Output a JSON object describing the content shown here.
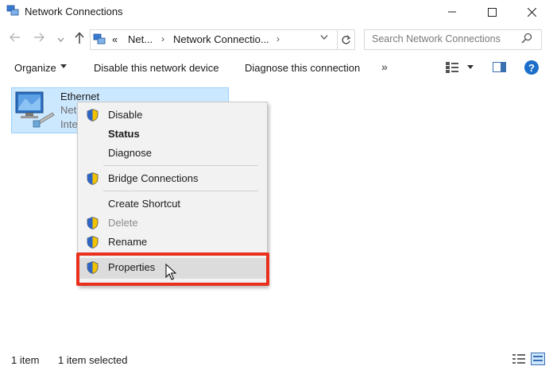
{
  "window": {
    "title": "Network Connections",
    "minimize_glyph": "—",
    "maximize_glyph": "☐",
    "close_glyph": "✕"
  },
  "nav": {
    "back_icon": "back-arrow-icon",
    "forward_icon": "forward-arrow-icon",
    "up_icon": "up-arrow-icon",
    "breadcrumb_prefix": "«",
    "breadcrumbs": [
      "Net...",
      "Network Connectio..."
    ],
    "refresh_icon": "refresh-icon"
  },
  "search": {
    "placeholder": "Search Network Connections"
  },
  "toolbar": {
    "organize_label": "Organize",
    "disable_label": "Disable this network device",
    "diagnose_label": "Diagnose this connection",
    "overflow_label": "»",
    "help_label": "?"
  },
  "connection": {
    "name": "Ethernet",
    "line2": "Net",
    "line3": "Inte"
  },
  "context_menu": {
    "items": [
      {
        "label": "Disable",
        "shield": true,
        "bold": false,
        "disabled": false
      },
      {
        "label": "Status",
        "shield": false,
        "bold": true,
        "disabled": false
      },
      {
        "label": "Diagnose",
        "shield": false,
        "bold": false,
        "disabled": false
      },
      {
        "label": "Bridge Connections",
        "shield": true,
        "bold": false,
        "disabled": false
      },
      {
        "label": "Create Shortcut",
        "shield": false,
        "bold": false,
        "disabled": false
      },
      {
        "label": "Delete",
        "shield": true,
        "bold": false,
        "disabled": true
      },
      {
        "label": "Rename",
        "shield": true,
        "bold": false,
        "disabled": false
      },
      {
        "label": "Properties",
        "shield": true,
        "bold": false,
        "disabled": false,
        "highlighted": true
      }
    ]
  },
  "status_bar": {
    "count": "1 item",
    "selected": "1 item selected"
  },
  "colors": {
    "selection_bg": "#cce8ff",
    "highlight_border": "#e8301c",
    "help_blue": "#1c6fc9"
  }
}
